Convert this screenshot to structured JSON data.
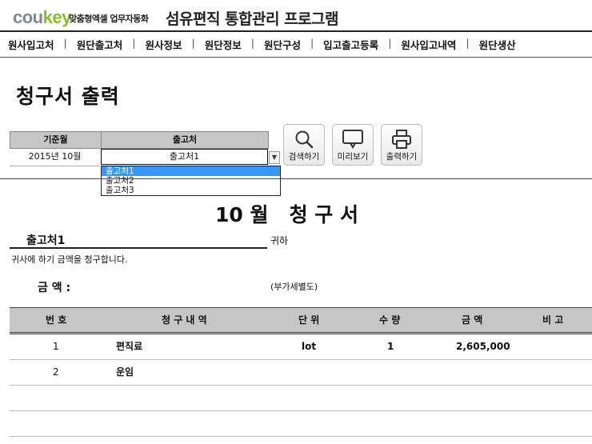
{
  "header": {
    "logo_part1": "cou",
    "logo_part2": "key",
    "slogan": "맞춤형엑셀 업무자동화",
    "app_title": "섬유편직 통합관리 프로그램"
  },
  "nav": {
    "items": [
      "원사입고처",
      "원단출고처",
      "원사정보",
      "원단정보",
      "원단구성",
      "입고출고등록",
      "원사입고내역",
      "원단생산"
    ]
  },
  "page_title": "청구서 출력",
  "filter": {
    "month_header": "기준월",
    "month_value": "2015년 10월",
    "dest_header": "출고처",
    "dest_value": "출고처1",
    "dropdown_options": [
      "출고처1",
      "출고처2",
      "출고처3"
    ],
    "dropdown_selected": "출고처1"
  },
  "buttons": {
    "search": "검색하기",
    "preview": "미리보기",
    "print": "출력하기"
  },
  "invoice": {
    "title": "10 월   청 구 서",
    "recipient": "출고처1",
    "honorific": "귀하",
    "request_text": "귀사에 하기 금액을 청구합니다.",
    "amount_label": "금 액 :",
    "vat_note": "(부가세별도)",
    "columns": [
      "번 호",
      "청 구 내 역",
      "단 위",
      "수 량",
      "금 액",
      "비 고"
    ],
    "rows": [
      {
        "no": "1",
        "item": "편직료",
        "unit": "lot",
        "qty": "1",
        "amount": "2,605,000",
        "note": ""
      },
      {
        "no": "2",
        "item": "운임",
        "unit": "",
        "qty": "",
        "amount": "",
        "note": ""
      },
      {
        "no": "",
        "item": "",
        "unit": "",
        "qty": "",
        "amount": "",
        "note": ""
      },
      {
        "no": "",
        "item": "",
        "unit": "",
        "qty": "",
        "amount": "",
        "note": ""
      }
    ]
  },
  "icons": {
    "search": "magnifier-icon",
    "preview": "monitor-icon",
    "print": "printer-icon",
    "dropdown": "chevron-down-icon"
  }
}
